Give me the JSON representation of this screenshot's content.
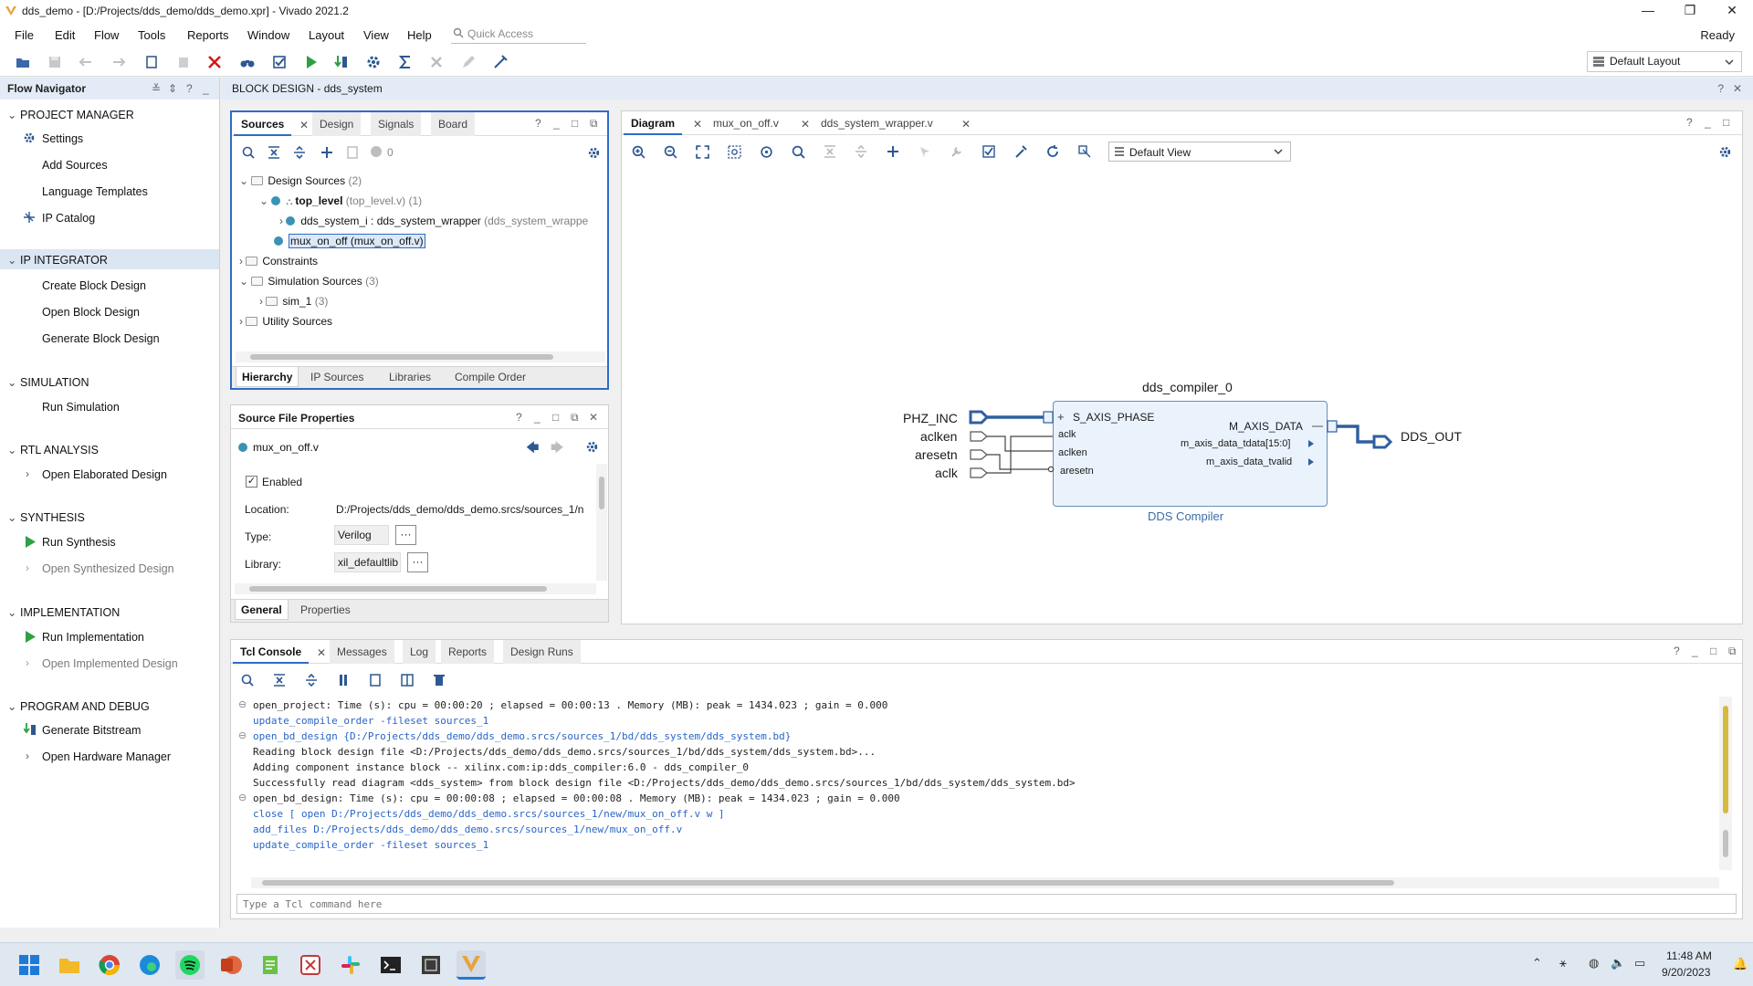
{
  "window": {
    "title": "dds_demo - [D:/Projects/dds_demo/dds_demo.xpr] - Vivado 2021.2",
    "minimize": "—",
    "maximize": "❐",
    "close": "✕"
  },
  "menu": {
    "items": [
      "File",
      "Edit",
      "Flow",
      "Tools",
      "Reports",
      "Window",
      "Layout",
      "View",
      "Help"
    ],
    "quick_access": "Quick Access",
    "status": "Ready"
  },
  "toolbar": {
    "layout": "Default Layout"
  },
  "flow_navigator": {
    "title": "Flow Navigator",
    "sections": [
      {
        "label": "PROJECT MANAGER",
        "items": [
          "Settings",
          "Add Sources",
          "Language Templates",
          "IP Catalog"
        ]
      },
      {
        "label": "IP INTEGRATOR",
        "items": [
          "Create Block Design",
          "Open Block Design",
          "Generate Block Design"
        ]
      },
      {
        "label": "SIMULATION",
        "items": [
          "Run Simulation"
        ]
      },
      {
        "label": "RTL ANALYSIS",
        "items": [
          "Open Elaborated Design"
        ]
      },
      {
        "label": "SYNTHESIS",
        "items": [
          "Run Synthesis",
          "Open Synthesized Design"
        ]
      },
      {
        "label": "IMPLEMENTATION",
        "items": [
          "Run Implementation",
          "Open Implemented Design"
        ]
      },
      {
        "label": "PROGRAM AND DEBUG",
        "items": [
          "Generate Bitstream",
          "Open Hardware Manager"
        ]
      }
    ]
  },
  "block_design": {
    "header": "BLOCK DESIGN - dds_system"
  },
  "sources": {
    "tabs": [
      "Sources",
      "Design",
      "Signals",
      "Board"
    ],
    "count": "0",
    "tree": {
      "design_sources": "Design Sources",
      "design_sources_count": "(2)",
      "top_level": "top_level",
      "top_level_file": "(top_level.v) (1)",
      "dds_system_i": "dds_system_i : dds_system_wrapper",
      "dds_system_i_file": "(dds_system_wrappe",
      "mux_on_off": "mux_on_off (mux_on_off.v)",
      "constraints": "Constraints",
      "simulation_sources": "Simulation Sources",
      "simulation_sources_count": "(3)",
      "sim_1": "sim_1",
      "sim_1_count": "(3)",
      "utility_sources": "Utility Sources"
    },
    "bottom_tabs": [
      "Hierarchy",
      "IP Sources",
      "Libraries",
      "Compile Order"
    ]
  },
  "properties": {
    "title": "Source File Properties",
    "file": "mux_on_off.v",
    "enabled_label": "Enabled",
    "location_label": "Location:",
    "location_value": "D:/Projects/dds_demo/dds_demo.srcs/sources_1/n",
    "type_label": "Type:",
    "type_value": "Verilog",
    "library_label": "Library:",
    "library_value": "xil_defaultlib",
    "more": "···",
    "bottom_tabs": [
      "General",
      "Properties"
    ]
  },
  "diagram": {
    "tabs": [
      "Diagram",
      "mux_on_off.v",
      "dds_system_wrapper.v"
    ],
    "view": "Default View",
    "block_name": "dds_compiler_0",
    "block_type": "DDS Compiler",
    "in_ports": [
      "S_AXIS_PHASE",
      "aclk",
      "aclken",
      "aresetn"
    ],
    "out_ports": [
      "M_AXIS_DATA",
      "m_axis_data_tdata[15:0]",
      "m_axis_data_tvalid"
    ],
    "ext_inputs": [
      "PHZ_INC",
      "aclken",
      "aresetn",
      "aclk"
    ],
    "ext_output": "DDS_OUT",
    "accent": "#2f5fa0"
  },
  "console": {
    "tabs": [
      "Tcl Console",
      "Messages",
      "Log",
      "Reports",
      "Design Runs"
    ],
    "lines": [
      {
        "text": "open_project: Time (s): cpu = 00:00:20 ; elapsed = 00:00:13 . Memory (MB): peak = 1434.023 ; gain = 0.000",
        "cmd": false
      },
      {
        "text": "update_compile_order -fileset sources_1",
        "cmd": true
      },
      {
        "text": "open_bd_design {D:/Projects/dds_demo/dds_demo.srcs/sources_1/bd/dds_system/dds_system.bd}",
        "cmd": true
      },
      {
        "text": "Reading block design file <D:/Projects/dds_demo/dds_demo.srcs/sources_1/bd/dds_system/dds_system.bd>...",
        "cmd": false
      },
      {
        "text": "Adding component instance block -- xilinx.com:ip:dds_compiler:6.0 - dds_compiler_0",
        "cmd": false
      },
      {
        "text": "Successfully read diagram <dds_system> from block design file <D:/Projects/dds_demo/dds_demo.srcs/sources_1/bd/dds_system/dds_system.bd>",
        "cmd": false
      },
      {
        "text": "open_bd_design: Time (s): cpu = 00:00:08 ; elapsed = 00:00:08 . Memory (MB): peak = 1434.023 ; gain = 0.000",
        "cmd": false
      },
      {
        "text": "close [ open D:/Projects/dds_demo/dds_demo.srcs/sources_1/new/mux_on_off.v w ]",
        "cmd": true
      },
      {
        "text": "add_files D:/Projects/dds_demo/dds_demo.srcs/sources_1/new/mux_on_off.v",
        "cmd": true
      },
      {
        "text": "update_compile_order -fileset sources_1",
        "cmd": true
      }
    ],
    "placeholder": "Type a Tcl command here"
  },
  "taskbar": {
    "time": "11:48 AM",
    "date": "9/20/2023"
  }
}
